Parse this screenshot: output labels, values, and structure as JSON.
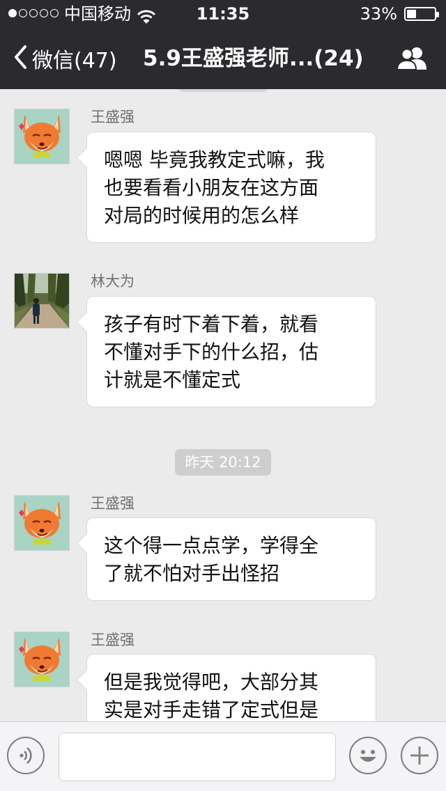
{
  "status_bar": {
    "carrier": "中国移动",
    "time": "11:35",
    "battery_percent": "33%",
    "battery_level": 0.33,
    "signal_bars": 1,
    "signal_bars_total": 5
  },
  "nav": {
    "back_label": "微信(47)",
    "title": "5.9王盛强老师...(24)",
    "back_icon": "chevron-left-icon",
    "group_icon": "group-members-icon"
  },
  "messages": [
    {
      "sender": "王盛强",
      "avatar": "fox-avatar",
      "lines": [
        "嗯嗯 毕竟我教定式嘛，我",
        "也要看看小朋友在这方面",
        "对局的时候用的怎么样"
      ]
    },
    {
      "sender": "林大为",
      "avatar": "photo-avatar",
      "lines": [
        "孩子有时下着下着，就看",
        "不懂对手下的什么招，估",
        "计就是不懂定式"
      ]
    },
    {
      "sender": "王盛强",
      "avatar": "fox-avatar",
      "lines": [
        "这个得一点点学，学得全",
        "了就不怕对手出怪招"
      ]
    },
    {
      "sender": "王盛强",
      "avatar": "fox-avatar",
      "lines": [
        "但是我觉得吧，大部分其",
        "实是对手走错了定式但是"
      ]
    }
  ],
  "timestamp": "昨天 20:12",
  "input_bar": {
    "voice_icon": "voice-icon",
    "emoji_icon": "emoji-icon",
    "plus_icon": "plus-icon",
    "input_value": ""
  },
  "colors": {
    "nav_background": "#2b2b2f",
    "chat_background": "#ebebeb",
    "bubble": "#ffffff"
  }
}
